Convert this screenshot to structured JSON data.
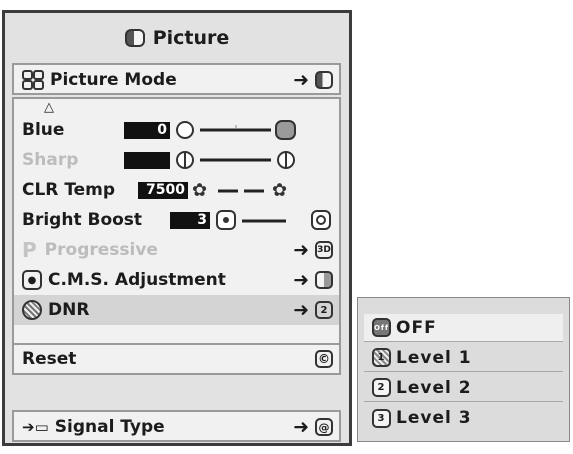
{
  "menu": {
    "title": "Picture",
    "picture_mode": "Picture Mode",
    "blue_label": "Blue",
    "blue_value": "0",
    "sharp_label": "Sharp",
    "clr_temp_label": "CLR Temp",
    "clr_temp_value": "7500",
    "bright_boost_label": "Bright Boost",
    "bright_boost_value": "3",
    "progressive_label": "Progressive",
    "progressive_icon_text": "3D",
    "cms_label": "C.M.S. Adjustment",
    "dnr_label": "DNR",
    "reset_label": "Reset",
    "signal_type_label": "Signal Type"
  },
  "dnr_submenu": {
    "options": [
      "OFF",
      "Level 1",
      "Level 2",
      "Level 3"
    ],
    "icon_labels": [
      "Off",
      "1",
      "2",
      "3"
    ],
    "selected": "OFF"
  },
  "colors": {
    "menu_bg": "#e2e2e2",
    "panel_bg": "#f1f1f1",
    "selected_row": "#d4d4d4",
    "value_box": "#111111",
    "faded_text": "#bcbcbc"
  }
}
